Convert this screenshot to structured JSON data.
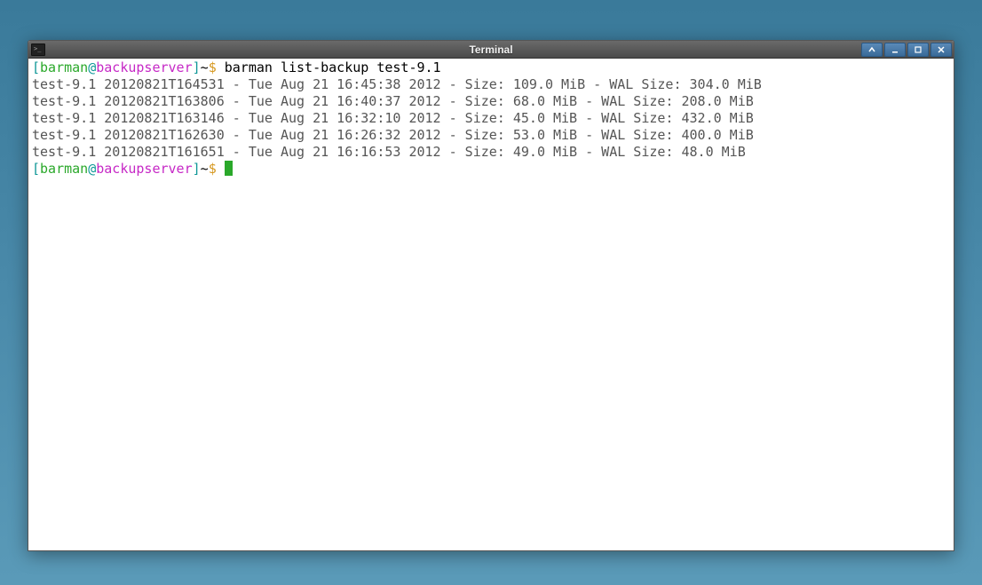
{
  "window": {
    "title": "Terminal"
  },
  "prompt": {
    "open_bracket": "[",
    "user": "barman",
    "at": "@",
    "host": "backupserver",
    "close_bracket": "]",
    "path": "~",
    "symbol": "$"
  },
  "command": "barman list-backup test-9.1",
  "output_lines": [
    "test-9.1 20120821T164531 - Tue Aug 21 16:45:38 2012 - Size: 109.0 MiB - WAL Size: 304.0 MiB",
    "test-9.1 20120821T163806 - Tue Aug 21 16:40:37 2012 - Size: 68.0 MiB - WAL Size: 208.0 MiB",
    "test-9.1 20120821T163146 - Tue Aug 21 16:32:10 2012 - Size: 45.0 MiB - WAL Size: 432.0 MiB",
    "test-9.1 20120821T162630 - Tue Aug 21 16:26:32 2012 - Size: 53.0 MiB - WAL Size: 400.0 MiB",
    "test-9.1 20120821T161651 - Tue Aug 21 16:16:53 2012 - Size: 49.0 MiB - WAL Size: 48.0 MiB"
  ]
}
